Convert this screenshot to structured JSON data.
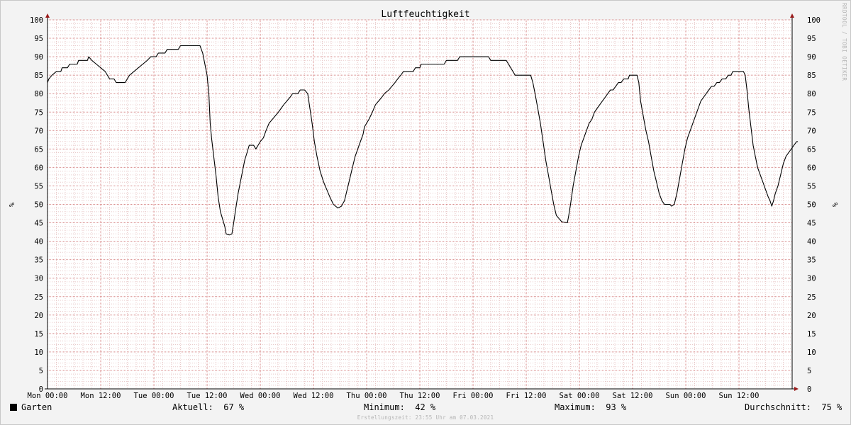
{
  "chart_data": {
    "type": "line",
    "title": "Luftfeuchtigkeit",
    "ylabel": "%",
    "ylabel_right": "%",
    "ylim": [
      0,
      100
    ],
    "yticks": [
      0,
      5,
      10,
      15,
      20,
      25,
      30,
      35,
      40,
      45,
      50,
      55,
      60,
      65,
      70,
      75,
      80,
      85,
      90,
      95,
      100
    ],
    "xlim": [
      0,
      168
    ],
    "x_unit": "hours since Mon 00:00",
    "xticks": [
      {
        "x": 0,
        "label": "Mon 00:00"
      },
      {
        "x": 12,
        "label": "Mon 12:00"
      },
      {
        "x": 24,
        "label": "Tue 00:00"
      },
      {
        "x": 36,
        "label": "Tue 12:00"
      },
      {
        "x": 48,
        "label": "Wed 00:00"
      },
      {
        "x": 60,
        "label": "Wed 12:00"
      },
      {
        "x": 72,
        "label": "Thu 00:00"
      },
      {
        "x": 84,
        "label": "Thu 12:00"
      },
      {
        "x": 96,
        "label": "Fri 00:00"
      },
      {
        "x": 108,
        "label": "Fri 12:00"
      },
      {
        "x": 120,
        "label": "Sat 00:00"
      },
      {
        "x": 132,
        "label": "Sat 12:00"
      },
      {
        "x": 144,
        "label": "Sun 00:00"
      },
      {
        "x": 156,
        "label": "Sun 12:00"
      }
    ],
    "grid": true,
    "series": [
      {
        "name": "Garten",
        "color": "#000000",
        "points": [
          [
            0.0,
            83
          ],
          [
            0.3,
            84
          ],
          [
            1.0,
            85
          ],
          [
            2.0,
            86
          ],
          [
            3.0,
            86
          ],
          [
            3.3,
            87
          ],
          [
            4.5,
            87
          ],
          [
            5.0,
            88
          ],
          [
            6.7,
            88
          ],
          [
            7.0,
            89
          ],
          [
            9.0,
            89
          ],
          [
            9.3,
            90
          ],
          [
            10.0,
            89
          ],
          [
            11.0,
            88
          ],
          [
            12.0,
            87
          ],
          [
            13.0,
            86
          ],
          [
            14.0,
            84
          ],
          [
            15.0,
            84
          ],
          [
            15.5,
            83
          ],
          [
            17.5,
            83
          ],
          [
            18.5,
            85
          ],
          [
            19.5,
            86
          ],
          [
            20.5,
            87
          ],
          [
            21.5,
            88
          ],
          [
            22.5,
            89
          ],
          [
            23.3,
            90
          ],
          [
            24.5,
            90
          ],
          [
            25.0,
            91
          ],
          [
            26.5,
            91
          ],
          [
            27.0,
            92
          ],
          [
            29.5,
            92
          ],
          [
            30.0,
            93
          ],
          [
            34.4,
            93
          ],
          [
            35.0,
            91
          ],
          [
            35.5,
            88
          ],
          [
            36.0,
            85
          ],
          [
            36.4,
            80
          ],
          [
            36.7,
            72
          ],
          [
            37.0,
            68
          ],
          [
            37.6,
            62
          ],
          [
            38.0,
            58
          ],
          [
            38.5,
            52
          ],
          [
            39.0,
            48
          ],
          [
            39.5,
            46
          ],
          [
            40.0,
            44
          ],
          [
            40.3,
            42
          ],
          [
            41.0,
            41.7
          ],
          [
            41.6,
            42
          ],
          [
            42.0,
            45
          ],
          [
            42.5,
            49
          ],
          [
            43.0,
            53
          ],
          [
            43.5,
            56
          ],
          [
            44.0,
            59
          ],
          [
            44.5,
            62
          ],
          [
            45.0,
            64
          ],
          [
            45.5,
            66
          ],
          [
            46.5,
            66
          ],
          [
            47.0,
            65
          ],
          [
            47.5,
            66
          ],
          [
            48.0,
            67
          ],
          [
            48.7,
            68
          ],
          [
            49.3,
            70
          ],
          [
            50.0,
            72
          ],
          [
            50.7,
            73
          ],
          [
            51.4,
            74
          ],
          [
            52.1,
            75
          ],
          [
            52.7,
            76
          ],
          [
            53.3,
            77
          ],
          [
            54.0,
            78
          ],
          [
            54.7,
            79
          ],
          [
            55.3,
            80
          ],
          [
            56.5,
            80
          ],
          [
            57.0,
            81
          ],
          [
            58.0,
            81
          ],
          [
            58.7,
            80
          ],
          [
            59.2,
            76
          ],
          [
            59.7,
            72
          ],
          [
            60.2,
            67
          ],
          [
            60.8,
            63
          ],
          [
            61.5,
            59
          ],
          [
            62.3,
            56
          ],
          [
            63.0,
            54
          ],
          [
            63.7,
            52
          ],
          [
            64.5,
            50
          ],
          [
            65.5,
            49
          ],
          [
            66.3,
            49.5
          ],
          [
            67.0,
            51
          ],
          [
            67.6,
            54
          ],
          [
            68.2,
            57
          ],
          [
            68.8,
            60
          ],
          [
            69.4,
            63
          ],
          [
            70.0,
            65
          ],
          [
            70.6,
            67
          ],
          [
            71.2,
            69
          ],
          [
            71.5,
            71
          ],
          [
            72.5,
            73
          ],
          [
            73.3,
            75
          ],
          [
            74.0,
            77
          ],
          [
            74.7,
            78
          ],
          [
            75.4,
            79
          ],
          [
            76.0,
            80
          ],
          [
            77.0,
            81
          ],
          [
            77.7,
            82
          ],
          [
            78.4,
            83
          ],
          [
            79.0,
            84
          ],
          [
            79.7,
            85
          ],
          [
            80.3,
            86
          ],
          [
            82.5,
            86
          ],
          [
            83.0,
            87
          ],
          [
            84.0,
            87
          ],
          [
            84.3,
            88
          ],
          [
            89.5,
            88
          ],
          [
            90.0,
            89
          ],
          [
            92.5,
            89
          ],
          [
            93.0,
            90
          ],
          [
            99.5,
            90
          ],
          [
            100.0,
            89
          ],
          [
            103.5,
            89
          ],
          [
            104.0,
            88
          ],
          [
            104.5,
            87
          ],
          [
            105.0,
            86
          ],
          [
            105.5,
            85
          ],
          [
            109.0,
            85
          ],
          [
            109.5,
            83
          ],
          [
            110.0,
            80
          ],
          [
            110.6,
            76
          ],
          [
            111.2,
            72
          ],
          [
            111.8,
            67
          ],
          [
            112.4,
            62
          ],
          [
            113.0,
            58
          ],
          [
            113.6,
            54
          ],
          [
            114.2,
            50
          ],
          [
            114.8,
            47
          ],
          [
            115.5,
            46
          ],
          [
            116.0,
            45.3
          ],
          [
            117.3,
            45
          ],
          [
            117.6,
            47
          ],
          [
            118.0,
            50
          ],
          [
            118.6,
            55
          ],
          [
            119.2,
            59
          ],
          [
            119.8,
            63
          ],
          [
            120.4,
            66
          ],
          [
            121.0,
            68
          ],
          [
            121.6,
            70
          ],
          [
            122.2,
            72
          ],
          [
            122.8,
            73
          ],
          [
            123.4,
            75
          ],
          [
            124.0,
            76
          ],
          [
            124.6,
            77
          ],
          [
            125.2,
            78
          ],
          [
            125.8,
            79
          ],
          [
            126.4,
            80
          ],
          [
            127.0,
            81
          ],
          [
            127.6,
            81
          ],
          [
            128.2,
            82
          ],
          [
            128.8,
            83
          ],
          [
            129.4,
            83
          ],
          [
            130.0,
            84
          ],
          [
            131.0,
            84
          ],
          [
            131.3,
            85
          ],
          [
            133.0,
            85
          ],
          [
            133.4,
            83
          ],
          [
            133.8,
            78
          ],
          [
            134.4,
            74
          ],
          [
            135.0,
            70
          ],
          [
            135.6,
            67
          ],
          [
            136.2,
            63
          ],
          [
            136.8,
            59
          ],
          [
            137.4,
            56
          ],
          [
            138.0,
            53
          ],
          [
            138.6,
            51
          ],
          [
            139.2,
            50
          ],
          [
            140.4,
            50
          ],
          [
            140.8,
            49.5
          ],
          [
            141.4,
            50
          ],
          [
            142.0,
            53
          ],
          [
            142.6,
            57
          ],
          [
            143.2,
            61
          ],
          [
            143.8,
            65
          ],
          [
            144.4,
            68
          ],
          [
            145.0,
            70
          ],
          [
            145.6,
            72
          ],
          [
            146.2,
            74
          ],
          [
            146.8,
            76
          ],
          [
            147.4,
            78
          ],
          [
            148.0,
            79
          ],
          [
            148.6,
            80
          ],
          [
            149.2,
            81
          ],
          [
            149.8,
            82
          ],
          [
            150.4,
            82
          ],
          [
            151.0,
            83
          ],
          [
            151.6,
            83
          ],
          [
            152.2,
            84
          ],
          [
            153.0,
            84
          ],
          [
            153.6,
            85
          ],
          [
            154.2,
            85
          ],
          [
            154.6,
            86
          ],
          [
            157.0,
            86
          ],
          [
            157.4,
            85
          ],
          [
            157.8,
            81
          ],
          [
            158.2,
            76
          ],
          [
            158.7,
            71
          ],
          [
            159.2,
            66
          ],
          [
            159.7,
            63
          ],
          [
            160.2,
            60
          ],
          [
            160.8,
            58
          ],
          [
            161.4,
            56
          ],
          [
            162.0,
            54
          ],
          [
            162.6,
            52
          ],
          [
            163.0,
            51
          ],
          [
            163.4,
            49.5
          ],
          [
            163.8,
            51
          ],
          [
            164.2,
            53
          ],
          [
            164.8,
            55
          ],
          [
            165.4,
            58
          ],
          [
            166.0,
            61
          ],
          [
            166.6,
            63
          ],
          [
            167.2,
            64
          ],
          [
            167.8,
            65
          ],
          [
            168.4,
            66
          ],
          [
            169.0,
            67
          ],
          [
            169.3,
            67
          ]
        ]
      }
    ]
  },
  "watermark": "RRDTOOL / TOBI OETIKER",
  "legend": {
    "series_name": "Garten",
    "current_label": "Aktuell:",
    "current_value": "67 %",
    "min_label": "Minimum:",
    "min_value": "42 %",
    "max_label": "Maximum:",
    "max_value": "93 %",
    "avg_label": "Durchschnitt:",
    "avg_value": "75 %"
  },
  "footer": "Erstellungszeit: 23:55 Uhr am 07.03.2021",
  "colors": {
    "background": "#f3f3f3",
    "plot_background": "#ffffff",
    "minor_grid": "#e8c8c8",
    "major_grid": "#d88a8a",
    "axis_arrow": "#9b1b1b",
    "line": "#000000"
  }
}
